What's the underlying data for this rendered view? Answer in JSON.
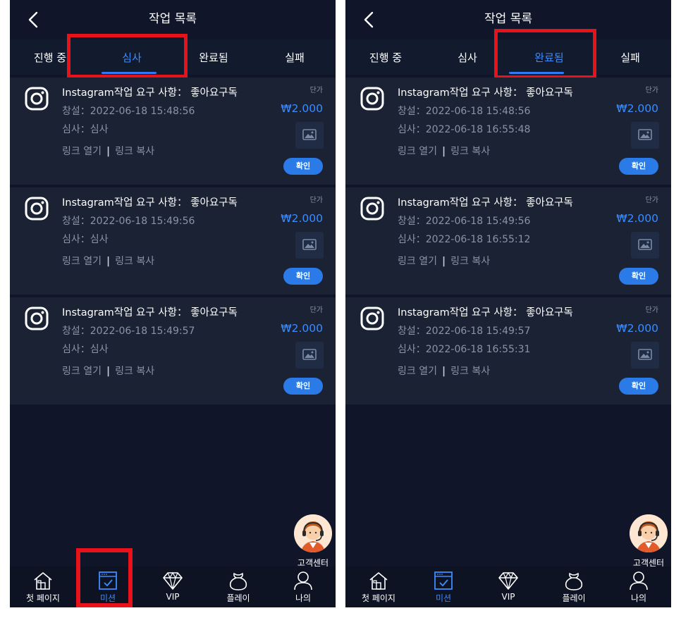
{
  "screens": [
    {
      "id": "left",
      "title": "작업 목록",
      "tabs": [
        {
          "label": "진행 중",
          "active": false
        },
        {
          "label": "심사",
          "active": true
        },
        {
          "label": "완료됨",
          "active": false
        },
        {
          "label": "실패",
          "active": false
        }
      ],
      "tasks": [
        {
          "title": "Instagram작업 요구 사항： 좋아요구독",
          "line1": "창설：2022-06-18 15:48:56",
          "line2": "심사：심사",
          "unit_label": "단가",
          "price": "₩2.000",
          "open_link": "링크 열기",
          "separator": "|",
          "copy_link": "링크 복사",
          "confirm": "확인"
        },
        {
          "title": "Instagram작업 요구 사항： 좋아요구독",
          "line1": "창설：2022-06-18 15:49:56",
          "line2": "심사：심사",
          "unit_label": "단가",
          "price": "₩2.000",
          "open_link": "링크 열기",
          "separator": "|",
          "copy_link": "링크 복사",
          "confirm": "확인"
        },
        {
          "title": "Instagram작업 요구 사항： 좋아요구독",
          "line1": "창설：2022-06-18 15:49:57",
          "line2": "심사：심사",
          "unit_label": "단가",
          "price": "₩2.000",
          "open_link": "링크 열기",
          "separator": "|",
          "copy_link": "링크 복사",
          "confirm": "확인"
        }
      ],
      "support_label": "고객센터",
      "nav": [
        {
          "label": "첫 페이지",
          "icon": "home-icon",
          "active": false
        },
        {
          "label": "미션",
          "icon": "mission-icon",
          "active": true
        },
        {
          "label": "VIP",
          "icon": "diamond-icon",
          "active": false
        },
        {
          "label": "플레이",
          "icon": "pouch-icon",
          "active": false
        },
        {
          "label": "나의",
          "icon": "user-icon",
          "active": false
        }
      ]
    },
    {
      "id": "right",
      "title": "작업 목록",
      "tabs": [
        {
          "label": "진행 중",
          "active": false
        },
        {
          "label": "심사",
          "active": false
        },
        {
          "label": "완료됨",
          "active": true
        },
        {
          "label": "실패",
          "active": false
        }
      ],
      "tasks": [
        {
          "title": "Instagram작업 요구 사항： 좋아요구독",
          "line1": "창설：2022-06-18 15:48:56",
          "line2": "심사：2022-06-18 16:55:48",
          "unit_label": "단가",
          "price": "₩2.000",
          "open_link": "링크 열기",
          "separator": "|",
          "copy_link": "링크 복사",
          "confirm": "확인"
        },
        {
          "title": "Instagram작업 요구 사항： 좋아요구독",
          "line1": "창설：2022-06-18 15:49:56",
          "line2": "심사：2022-06-18 16:55:12",
          "unit_label": "단가",
          "price": "₩2.000",
          "open_link": "링크 열기",
          "separator": "|",
          "copy_link": "링크 복사",
          "confirm": "확인"
        },
        {
          "title": "Instagram작업 요구 사항： 좋아요구독",
          "line1": "창설：2022-06-18 15:49:57",
          "line2": "심사：2022-06-18 16:55:31",
          "unit_label": "단가",
          "price": "₩2.000",
          "open_link": "링크 열기",
          "separator": "|",
          "copy_link": "링크 복사",
          "confirm": "확인"
        }
      ],
      "support_label": "고객센터",
      "nav": [
        {
          "label": "첫 페이지",
          "icon": "home-icon",
          "active": false
        },
        {
          "label": "미션",
          "icon": "mission-icon",
          "active": true
        },
        {
          "label": "VIP",
          "icon": "diamond-icon",
          "active": false
        },
        {
          "label": "플레이",
          "icon": "pouch-icon",
          "active": false
        },
        {
          "label": "나의",
          "icon": "user-icon",
          "active": false
        }
      ]
    }
  ],
  "colors": {
    "background": "#101529",
    "card": "#1a2234",
    "accent": "#3b8cff",
    "highlight": "#e8121b"
  }
}
